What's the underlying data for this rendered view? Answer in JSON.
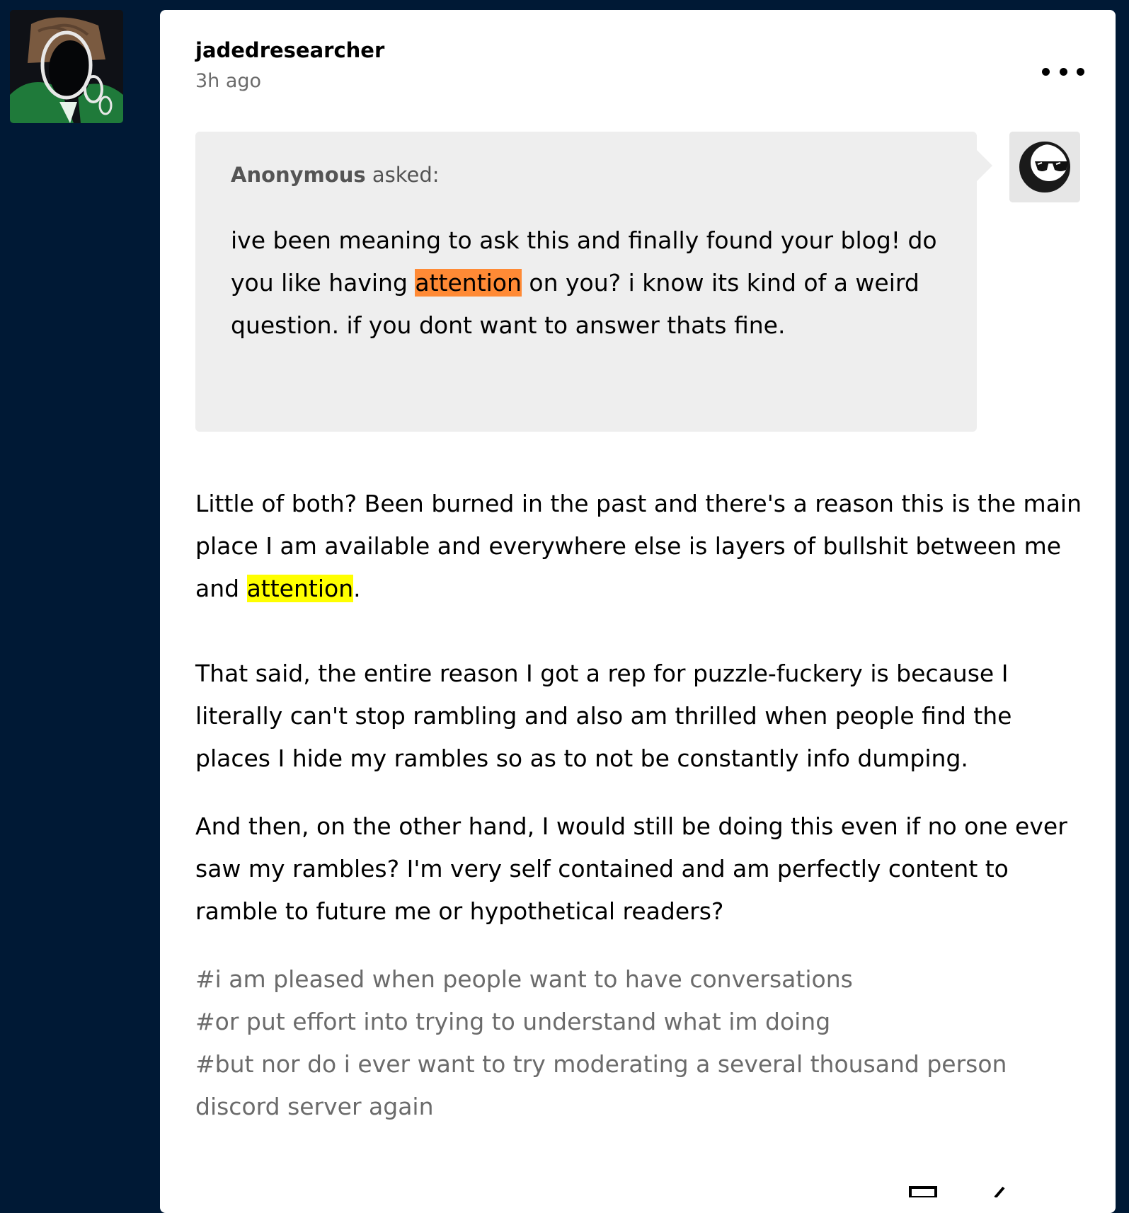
{
  "post": {
    "author": "jadedresearcher",
    "timestamp": "3h ago",
    "ask": {
      "asker": "Anonymous",
      "asked_label": "asked:",
      "question_before": "ive been meaning to ask this and finally found your blog! do you like having ",
      "question_highlight": "attention",
      "question_after": " on you? i know its kind of a weird question. if you dont want to answer thats fine."
    },
    "answer": {
      "p1_before": "Little of both? Been burned in the past and there's a reason this is the main place I am available and everywhere else is layers of bullshit between me and ",
      "p1_highlight": "attention",
      "p1_after": ".",
      "p2": "That said, the entire reason I got a rep for puzzle-fuckery is because I literally can't stop rambling and also am thrilled when people find the places I hide my rambles so as to not be constantly info dumping.",
      "p3": "And then, on the other hand, I would still be doing this even if no one ever saw my rambles? I'm very self contained and am perfectly content to ramble to future me or hypothetical readers?"
    },
    "tags": [
      "#i am pleased when people want to have conversations",
      "#or put effort into trying to understand what im doing",
      "#but nor do i ever want to try moderating a several thousand person discord server again"
    ]
  },
  "icons": {
    "more": "more-options-icon",
    "avatar": "user-avatar",
    "anon_avatar": "anonymous-sunglasses-avatar"
  },
  "colors": {
    "background": "#001935",
    "card": "#ffffff",
    "ask_box": "#eeeeee",
    "highlight_orange": "#ff8a35",
    "highlight_yellow": "#ffff00",
    "muted_text": "#6b6b6b"
  }
}
